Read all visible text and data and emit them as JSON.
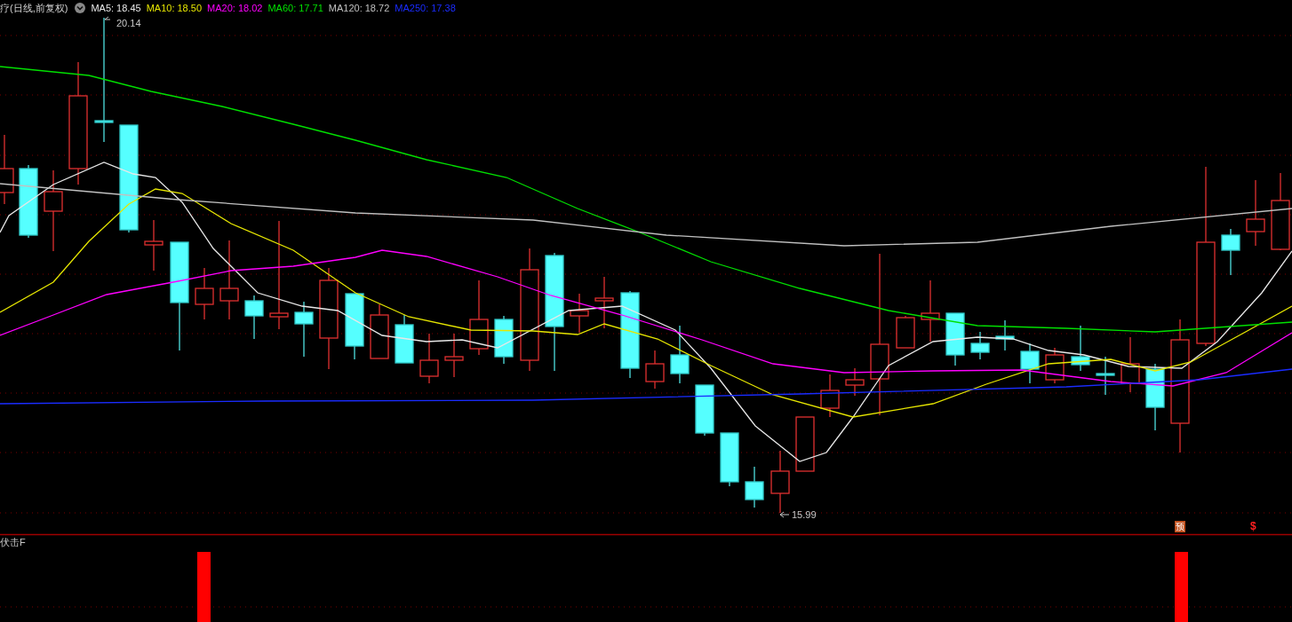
{
  "title": "疗(日线,前复权)",
  "moving_averages": [
    {
      "label": "MA5: 18.45",
      "color": "#e8e8e8"
    },
    {
      "label": "MA10: 18.50",
      "color": "#e6e600"
    },
    {
      "label": "MA20: 18.02",
      "color": "#ff00ff"
    },
    {
      "label": "MA60: 17.71",
      "color": "#00e000"
    },
    {
      "label": "MA120: 18.72",
      "color": "#c0c0c0"
    },
    {
      "label": "MA250: 17.38",
      "color": "#1a2cff"
    }
  ],
  "price_chart": {
    "high_label": "20.14",
    "low_label": "15.99"
  },
  "indicator": {
    "name": "伏击F",
    "markers": [
      {
        "kind": "badge",
        "text": "预"
      },
      {
        "kind": "symbol",
        "text": "$"
      }
    ]
  }
}
